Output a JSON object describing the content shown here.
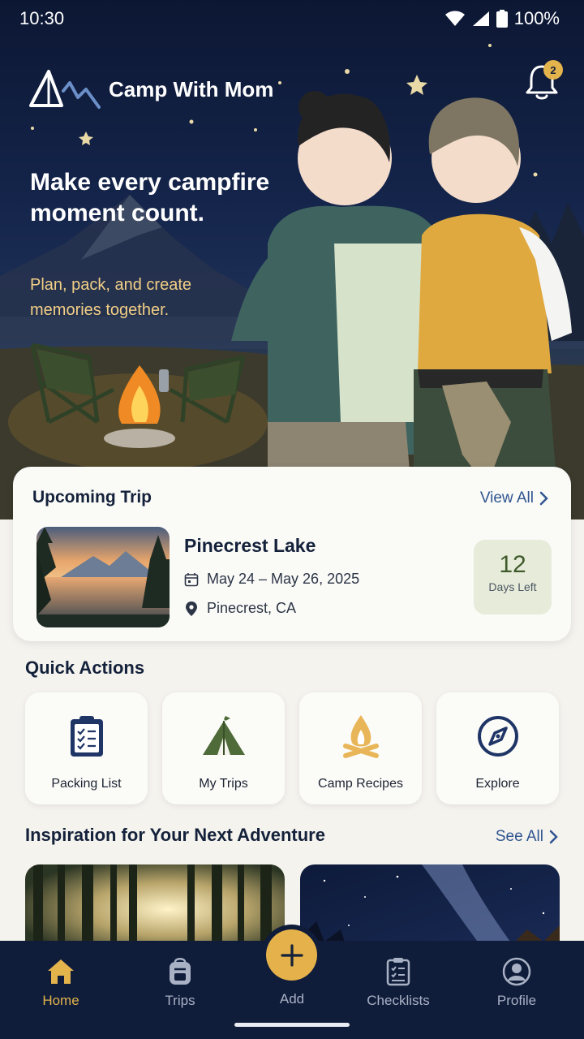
{
  "status_bar": {
    "time": "10:30",
    "battery": "100%"
  },
  "brand": {
    "name": "Camp With Mom"
  },
  "notifications": {
    "count": "2"
  },
  "hero": {
    "title": "Make every campfire moment count.",
    "subtitle": "Plan, pack, and create memories together."
  },
  "upcoming": {
    "heading": "Upcoming Trip",
    "view_all": "View All",
    "trip_name": "Pinecrest Lake",
    "dates": "May 24 – May 26, 2025",
    "location": "Pinecrest, CA",
    "days_number": "12",
    "days_label": "Days Left"
  },
  "quick_actions": {
    "heading": "Quick Actions",
    "items": [
      {
        "label": "Packing List",
        "icon": "clipboard-checklist-icon"
      },
      {
        "label": "My Trips",
        "icon": "tent-icon"
      },
      {
        "label": "Camp Recipes",
        "icon": "campfire-icon"
      },
      {
        "label": "Explore",
        "icon": "compass-icon"
      }
    ]
  },
  "inspiration": {
    "heading": "Inspiration for Your Next Adventure",
    "see_all": "See All"
  },
  "nav": {
    "home": "Home",
    "trips": "Trips",
    "add": "Add",
    "checklists": "Checklists",
    "profile": "Profile"
  },
  "colors": {
    "navy": "#0f1c3a",
    "accent_gold": "#e3b34c",
    "link_blue": "#2f5590",
    "days_bg": "#e6ecd9",
    "days_text": "#3f5a2b"
  }
}
